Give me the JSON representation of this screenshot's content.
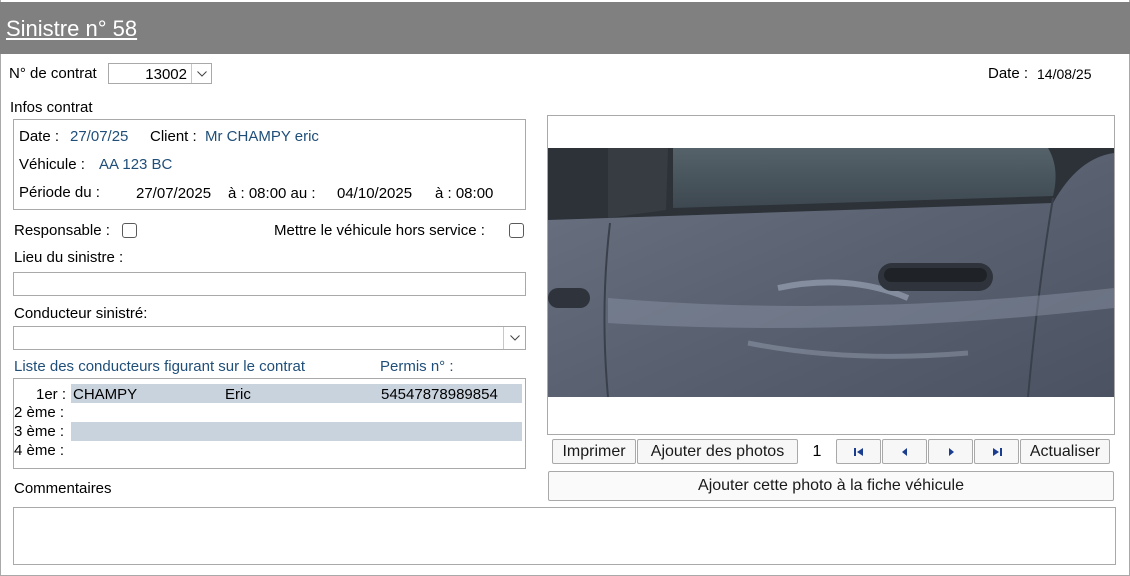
{
  "title": "Sinistre n° 58",
  "contract": {
    "label": "N° de contrat",
    "value": "13002"
  },
  "date": {
    "label": "Date :",
    "value": "14/08/25"
  },
  "infos": {
    "heading": "Infos contrat",
    "date_label": "Date :",
    "date_value": "27/07/25",
    "client_label": "Client :",
    "client_value": "Mr CHAMPY eric",
    "vehicle_label": "Véhicule :",
    "vehicle_value": "AA 123 BC",
    "period_label": "Période du :",
    "period_start": "27/07/2025",
    "at_label_1": "à : 08:00 au :",
    "period_end": "04/10/2025",
    "at_label_2": "à : 08:00"
  },
  "responsable_label": "Responsable :",
  "hors_service_label": "Mettre le véhicule hors service :",
  "lieu_label": "Lieu du sinistre :",
  "conducteur_label": "Conducteur sinistré:",
  "drivers": {
    "list_label": "Liste des conducteurs figurant sur le contrat",
    "permis_label": "Permis n° :",
    "rows": [
      {
        "rank": "1er :",
        "last": "CHAMPY",
        "first": "Eric",
        "permis": "54547878989854"
      },
      {
        "rank": "2 ème :",
        "last": "",
        "first": "",
        "permis": ""
      },
      {
        "rank": "3 ème :",
        "last": "",
        "first": "",
        "permis": ""
      },
      {
        "rank": "4 ème :",
        "last": "",
        "first": "",
        "permis": ""
      }
    ]
  },
  "commentaires_label": "Commentaires",
  "photo_toolbar": {
    "print": "Imprimer",
    "add_photos": "Ajouter des photos",
    "page": "1",
    "refresh": "Actualiser",
    "add_to_vehicle": "Ajouter cette photo à la fiche véhicule"
  },
  "icons": [
    "first-page-icon",
    "prev-icon",
    "next-icon",
    "last-page-icon",
    "chevron-down-icon"
  ]
}
